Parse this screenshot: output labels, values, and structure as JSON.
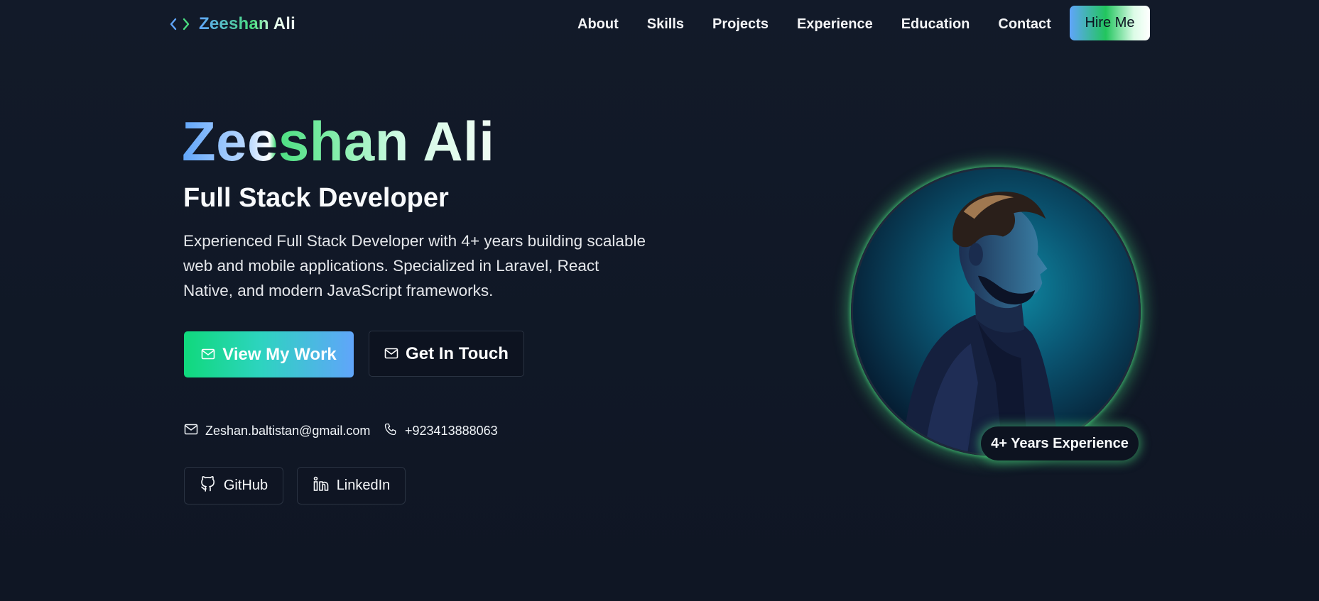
{
  "nav": {
    "logo_text": "Zeeshan Ali",
    "links": [
      "About",
      "Skills",
      "Projects",
      "Experience",
      "Education",
      "Contact"
    ],
    "hire_label": "Hire Me"
  },
  "hero": {
    "name": "Zeeshan Ali",
    "role": "Full Stack Developer",
    "description": "Experienced Full Stack Developer with 4+ years building scalable web and mobile applications. Specialized in Laravel, React Native, and modern JavaScript frameworks.",
    "primary_button": "View My Work",
    "secondary_button": "Get In Touch",
    "email": "Zeshan.baltistan@gmail.com",
    "phone": "+923413888063",
    "social": {
      "github": "GitHub",
      "linkedin": "LinkedIn"
    },
    "badge": "4+ Years Experience"
  },
  "icons": {
    "logo": "code-brackets-icon",
    "primary_button": "mail-icon",
    "secondary_button": "mail-icon",
    "email": "mail-icon",
    "phone": "phone-icon",
    "github": "github-icon",
    "linkedin": "linkedin-icon"
  },
  "colors": {
    "background": "#111827",
    "accent_green": "#4ade80",
    "accent_blue": "#60a5fa",
    "primary_button_start": "#10d97c",
    "primary_button_end": "#60a5fa"
  }
}
